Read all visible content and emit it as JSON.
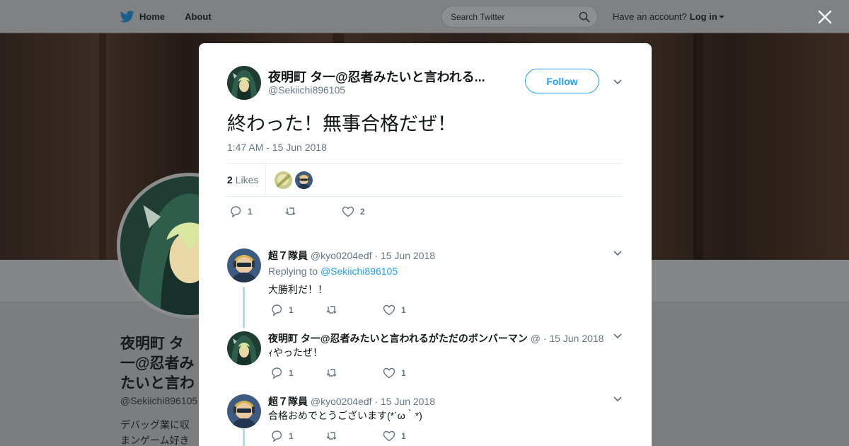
{
  "nav": {
    "home": "Home",
    "about": "About",
    "search_placeholder": "Search Twitter",
    "have_account": "Have an account?",
    "login": "Log in"
  },
  "background_profile": {
    "name": "夜明町 タ一@忍者みたいと言われるがただのボンバーマン",
    "handle": "@Sekiichi896105",
    "bio": "デバッグ業に収まンゲーム好きの人"
  },
  "tweet": {
    "author_name": "夜明町 タ一@忍者みたいと言われる...",
    "author_handle": "@Sekiichi896105",
    "follow_label": "Follow",
    "text": "終わった！無事合格だぜ！",
    "timestamp": "1:47 AM - 15 Jun 2018",
    "likes_count": "2",
    "likes_label": "Likes",
    "reply_count": "1",
    "like_count": "2"
  },
  "replies": [
    {
      "name": "超７隊員",
      "handle": "@kyo0204edf",
      "date": "· 15 Jun 2018",
      "replying_label": "Replying to",
      "replying_to": "@Sekiichi896105",
      "text": "大勝利だ！！",
      "reply_count": "1",
      "like_count": "1"
    },
    {
      "name": "夜明町 タ一@忍者みたいと言われるがただのボンバーマン",
      "handle": "@",
      "date": "· 15 Jun 2018",
      "text": "ｨやったぜ！",
      "reply_count": "1",
      "like_count": "1"
    },
    {
      "name": "超７隊員",
      "handle": "@kyo0204edf",
      "date": "· 15 Jun 2018",
      "text": "合格おめでとうございます(*´ω｀*)",
      "reply_count": "1",
      "like_count": "1"
    }
  ],
  "colors": {
    "accent": "#1da1f2",
    "thread_line": "#a8dbf7",
    "secondary_text": "#657786"
  }
}
